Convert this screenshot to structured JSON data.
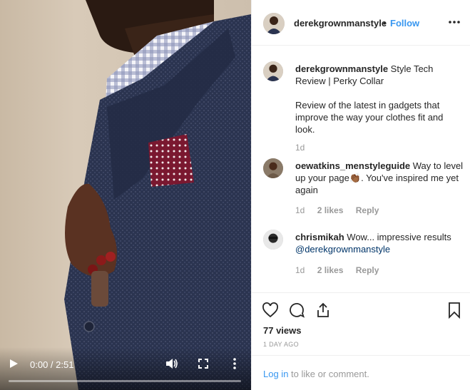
{
  "video": {
    "time_current": "0:00",
    "time_total": "2:51",
    "progress": 0
  },
  "post": {
    "author": "derekgrownmanstyle",
    "header_separator": "•",
    "follow_label": "Follow",
    "caption_title": "Style Tech Review | Perky Collar",
    "caption_body": "Review of the latest in gadgets that improve the way your clothes fit and look.",
    "caption_age": "1d",
    "views": "77 views",
    "posted": "1 DAY AGO"
  },
  "comments": [
    {
      "username": "oewatkins_menstyleguide",
      "text_before": "Way to level up your page",
      "emoji": "👏🏾",
      "text_after": ". You've inspired me yet again",
      "age": "1d",
      "likes": "2 likes",
      "reply": "Reply"
    },
    {
      "username": "chrismikah",
      "text_before": "Wow... impressive results",
      "mention": "@derekgrownmanstyle",
      "age": "1d",
      "likes": "2 likes",
      "reply": "Reply"
    }
  ],
  "login_bar": {
    "link": "Log in",
    "text": "to like or comment."
  },
  "icons": {
    "like": "heart-icon",
    "comment": "comment-icon",
    "share": "share-icon",
    "save": "bookmark-icon",
    "more": "more-options-icon"
  },
  "colors": {
    "accent": "#3897f0",
    "mention": "#003569",
    "muted": "#999999",
    "border": "#efefef"
  }
}
